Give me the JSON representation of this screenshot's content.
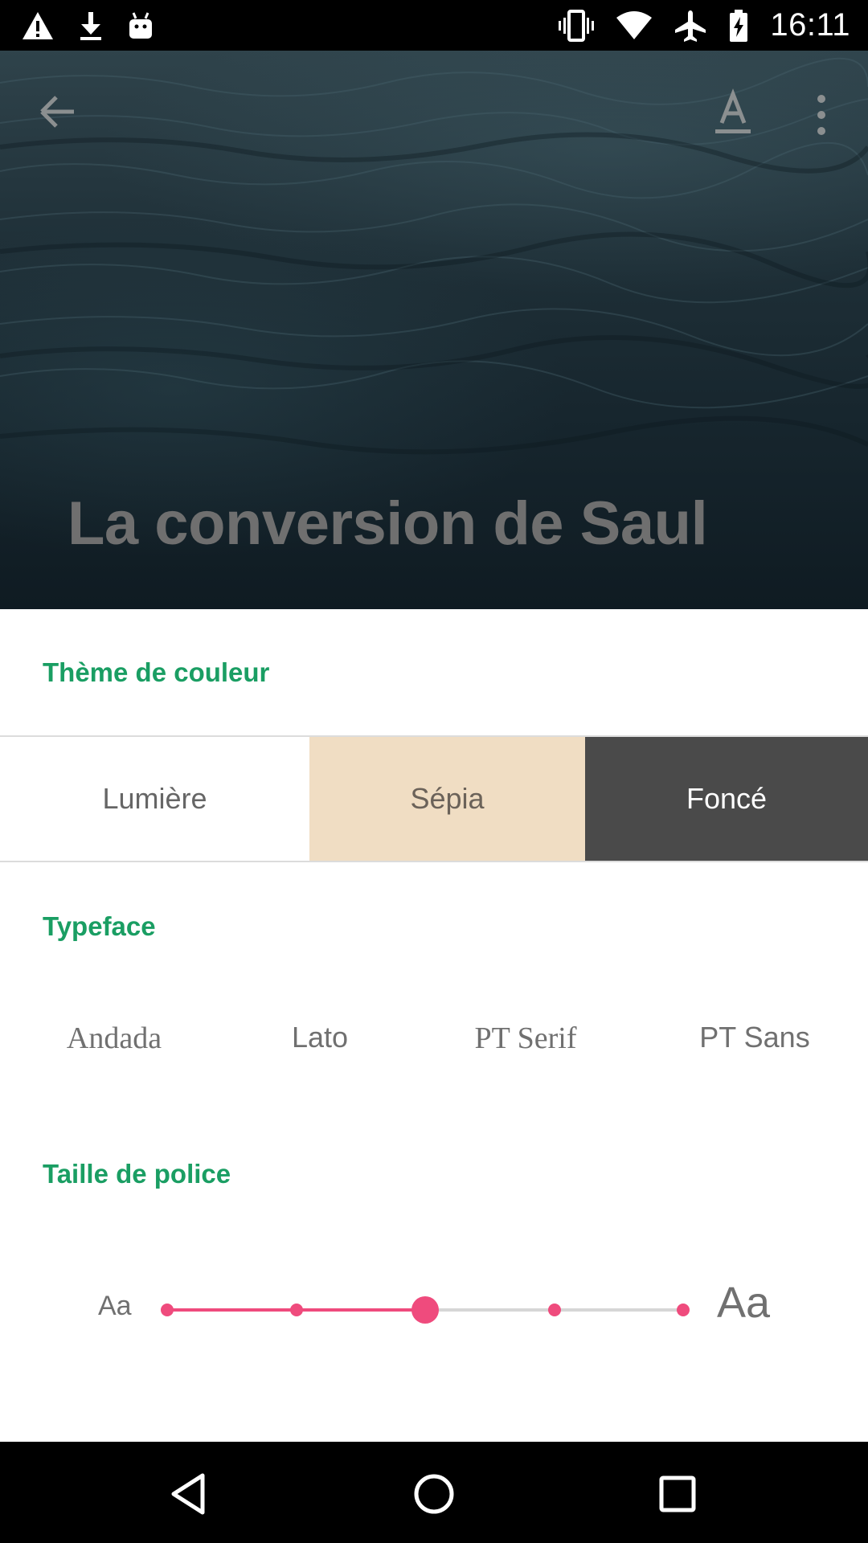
{
  "status_bar": {
    "time": "16:11",
    "left_icons": [
      "warning-icon",
      "download-icon",
      "android-icon"
    ],
    "right_icons": [
      "vibrate-icon",
      "wifi-icon",
      "airplane-icon",
      "battery-icon"
    ]
  },
  "hero": {
    "title": "La conversion de Saul",
    "toolbar": {
      "back_icon": "arrow-back-icon",
      "font_icon": "text-format-icon",
      "menu_icon": "more-vert-icon"
    }
  },
  "settings": {
    "theme_label": "Thème de couleur",
    "themes": [
      "Lumière",
      "Sépia",
      "Foncé"
    ],
    "selected_theme": "Foncé",
    "typeface_label": "Typeface",
    "typefaces": [
      "Andada",
      "Lato",
      "PT Serif",
      "PT Sans"
    ],
    "font_size_label": "Taille de police",
    "font_size_small": "Aa",
    "font_size_large": "Aa",
    "font_size_steps": 5,
    "font_size_selected_index": 2
  },
  "nav_bar": {
    "icons": [
      "back-triangle-icon",
      "home-circle-icon",
      "recents-square-icon"
    ]
  },
  "colors": {
    "accent_green": "#1a9e63",
    "slider_pink": "#ef4b7d",
    "sepia": "#f0ddc3",
    "dark": "#4a4a4a"
  }
}
